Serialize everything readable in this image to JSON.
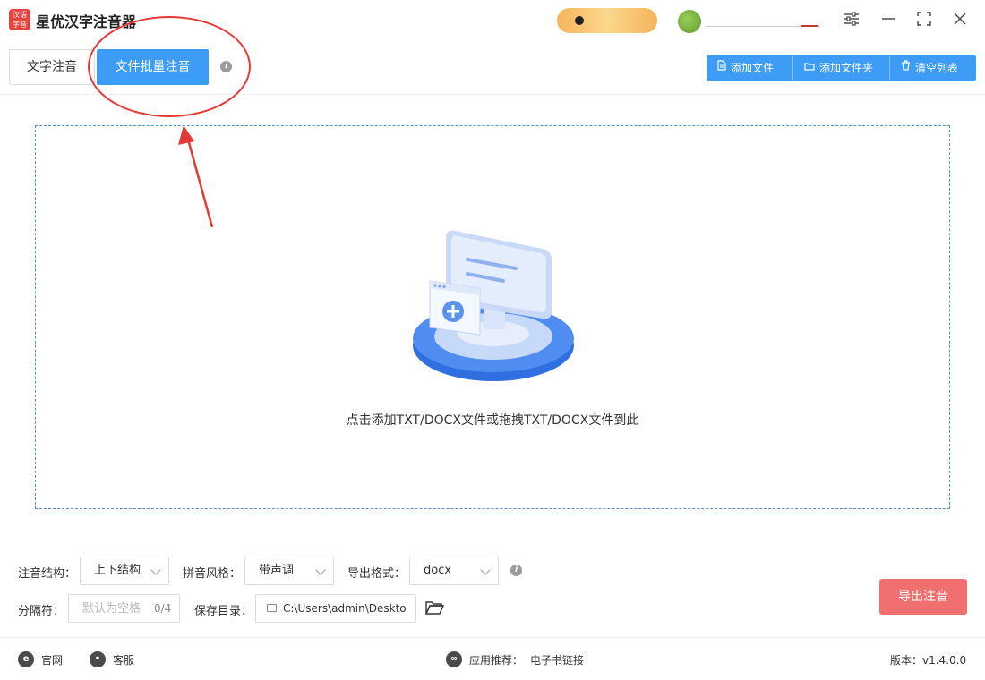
{
  "app": {
    "logo_text": "汉语\n字音",
    "title": "星优汉字注音器"
  },
  "window": {
    "settings_icon": "sliders-icon",
    "minimize_icon": "minimize-icon",
    "maximize_icon": "maximize-icon",
    "close_icon": "close-icon"
  },
  "tabs": [
    {
      "label": "文字注音",
      "active": false
    },
    {
      "label": "文件批量注音",
      "active": true
    }
  ],
  "toolbar": {
    "add_file": "添加文件",
    "add_folder": "添加文件夹",
    "clear_list": "清空列表"
  },
  "dropzone": {
    "hint": "点击添加TXT/DOCX文件或拖拽TXT/DOCX文件到此"
  },
  "options": {
    "structure_label": "注音结构：",
    "structure_value": "上下结构",
    "style_label": "拼音风格：",
    "style_value": "带声调",
    "format_label": "导出格式：",
    "format_value": "docx",
    "separator_label": "分隔符：",
    "separator_placeholder": "默认为空格",
    "separator_count": "0/4",
    "save_dir_label": "保存目录：",
    "save_dir_value": "C:\\Users\\admin\\Deskto"
  },
  "export_button": "导出注音",
  "statusbar": {
    "official_site": "官网",
    "customer_service": "客服",
    "recommend_label": "应用推荐：",
    "recommend_value": "电子书链接",
    "version": "版本：v1.4.0.0"
  },
  "colors": {
    "accent_blue": "#3d9cf5",
    "export_red": "#f07070",
    "annotation_red": "#e53935"
  }
}
